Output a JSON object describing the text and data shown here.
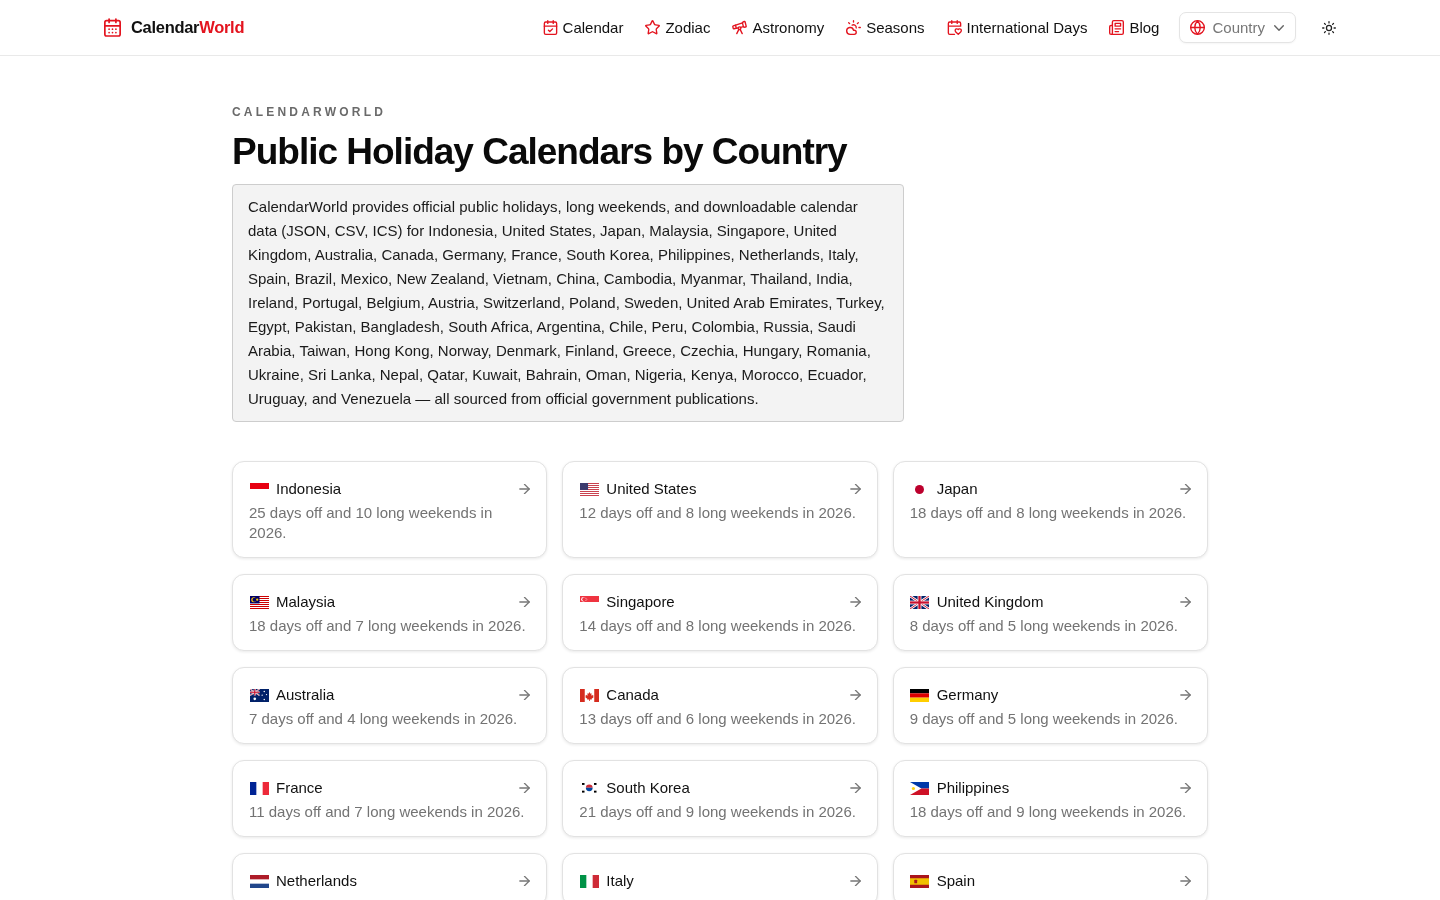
{
  "header": {
    "logo": {
      "text": "Calendar",
      "accent": "World"
    },
    "nav": [
      {
        "label": "Calendar"
      },
      {
        "label": "Zodiac"
      },
      {
        "label": "Astronomy"
      },
      {
        "label": "Seasons"
      },
      {
        "label": "International Days"
      },
      {
        "label": "Blog"
      }
    ],
    "country_select": {
      "placeholder": "Country"
    }
  },
  "eyebrow": "CALENDARWORLD",
  "title": "Public Holiday Calendars by Country",
  "intro": "CalendarWorld provides official public holidays, long weekends, and downloadable calendar data (JSON, CSV, ICS) for Indonesia, United States, Japan, Malaysia, Singapore, United Kingdom, Australia, Canada, Germany, France, South Korea, Philippines, Netherlands, Italy, Spain, Brazil, Mexico, New Zealand, Vietnam, China, Cambodia, Myanmar, Thailand, India, Ireland, Portugal, Belgium, Austria, Switzerland, Poland, Sweden, United Arab Emirates, Turkey, Egypt, Pakistan, Bangladesh, South Africa, Argentina, Chile, Peru, Colombia, Russia, Saudi Arabia, Taiwan, Hong Kong, Norway, Denmark, Finland, Greece, Czechia, Hungary, Romania, Ukraine, Sri Lanka, Nepal, Qatar, Kuwait, Bahrain, Oman, Nigeria, Kenya, Morocco, Ecuador, Uruguay, and Venezuela — all sourced from official government publications.",
  "countries": [
    {
      "name": "Indonesia",
      "summary": "25 days off and 10 long weekends in 2026."
    },
    {
      "name": "United States",
      "summary": "12 days off and 8 long weekends in 2026."
    },
    {
      "name": "Japan",
      "summary": "18 days off and 8 long weekends in 2026."
    },
    {
      "name": "Malaysia",
      "summary": "18 days off and 7 long weekends in 2026."
    },
    {
      "name": "Singapore",
      "summary": "14 days off and 8 long weekends in 2026."
    },
    {
      "name": "United Kingdom",
      "summary": "8 days off and 5 long weekends in 2026."
    },
    {
      "name": "Australia",
      "summary": "7 days off and 4 long weekends in 2026."
    },
    {
      "name": "Canada",
      "summary": "13 days off and 6 long weekends in 2026."
    },
    {
      "name": "Germany",
      "summary": "9 days off and 5 long weekends in 2026."
    },
    {
      "name": "France",
      "summary": "11 days off and 7 long weekends in 2026."
    },
    {
      "name": "South Korea",
      "summary": "21 days off and 9 long weekends in 2026."
    },
    {
      "name": "Philippines",
      "summary": "18 days off and 9 long weekends in 2026."
    },
    {
      "name": "Netherlands"
    },
    {
      "name": "Italy"
    },
    {
      "name": "Spain"
    }
  ]
}
